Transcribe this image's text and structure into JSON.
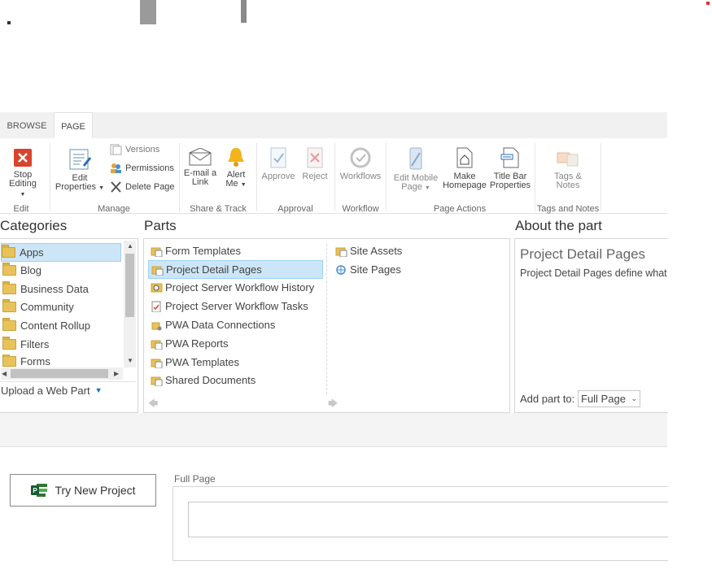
{
  "ribbon": {
    "tabs": [
      {
        "label": "BROWSE"
      },
      {
        "label": "PAGE"
      }
    ],
    "stop_editing": {
      "label": "Stop Editing"
    },
    "edit_properties": {
      "label1": "Edit",
      "label2": "Properties"
    },
    "versions": {
      "label": "Versions"
    },
    "permissions": {
      "label": "Permissions"
    },
    "delete_page": {
      "label": "Delete Page"
    },
    "email_link": {
      "label1": "E-mail a",
      "label2": "Link"
    },
    "alert_me": {
      "label1": "Alert",
      "label2": "Me"
    },
    "approve": {
      "label": "Approve"
    },
    "reject": {
      "label": "Reject"
    },
    "workflows": {
      "label": "Workflows"
    },
    "edit_mobile": {
      "label1": "Edit Mobile",
      "label2": "Page"
    },
    "make_homepage": {
      "label1": "Make",
      "label2": "Homepage"
    },
    "title_bar": {
      "label1": "Title Bar",
      "label2": "Properties"
    },
    "tags_notes": {
      "label1": "Tags &",
      "label2": "Notes"
    },
    "groups": {
      "edit": "Edit",
      "manage": "Manage",
      "share": "Share & Track",
      "approval": "Approval",
      "workflow": "Workflow",
      "page_actions": "Page Actions",
      "tags": "Tags and Notes"
    }
  },
  "categories": {
    "header": "Categories",
    "items": [
      "Apps",
      "Blog",
      "Business Data",
      "Community",
      "Content Rollup",
      "Filters",
      "Forms"
    ],
    "upload_label": "Upload a Web Part"
  },
  "parts": {
    "header": "Parts",
    "left": [
      "Form Templates",
      "Project Detail Pages",
      "Project Server Workflow History",
      "Project Server Workflow Tasks",
      "PWA Data Connections",
      "PWA Reports",
      "PWA Templates",
      "Shared Documents"
    ],
    "right": [
      "Site Assets",
      "Site Pages"
    ]
  },
  "about": {
    "header": "About the part",
    "title": "Project Detail Pages",
    "description": "Project Detail Pages define what",
    "add_part_label": "Add part to:",
    "add_part_value": "Full Page"
  },
  "footer": {
    "try_button": "Try New Project",
    "zone_label": "Full Page"
  },
  "colors": {
    "accent": "#0072c6",
    "selection": "#cde6f7",
    "stop_red": "#d9442c",
    "project_green": "#31752f"
  }
}
